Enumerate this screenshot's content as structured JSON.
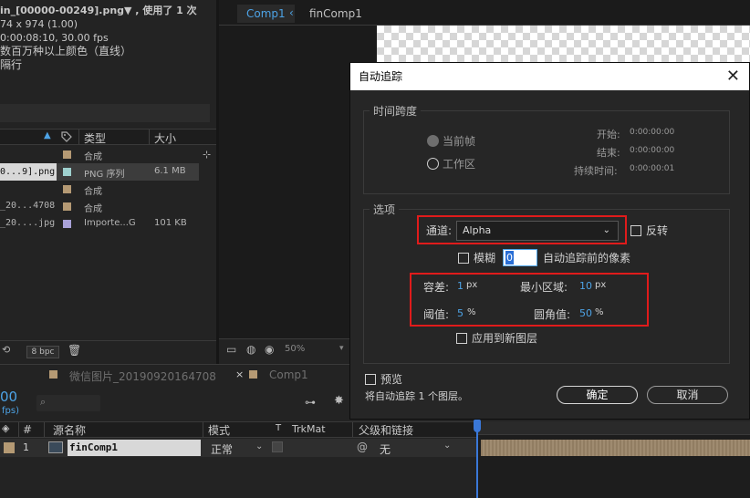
{
  "project": {
    "info_line1": "in_[00000-00249].png▼ , 使用了 1 次",
    "info_line2": "74 x 974 (1.00)",
    "info_line3": "0:00:08:10, 30.00 fps",
    "info_line4": "数百万种以上颜色（直线）",
    "info_line5": "隔行",
    "col_type": "类型",
    "col_size": "大小",
    "rows": [
      {
        "name": "",
        "type": "合成",
        "size": "",
        "color": "#b59a74"
      },
      {
        "name": "0...9].png",
        "type": "PNG 序列",
        "size": "6.1 MB",
        "color": "#9fd1cf"
      },
      {
        "name": "",
        "type": "合成",
        "size": "",
        "color": "#b59a74"
      },
      {
        "name": "_20...4708",
        "type": "合成",
        "size": "",
        "color": "#b59a74"
      },
      {
        "name": "_20....jpg",
        "type": "Importe...G",
        "size": "101 KB",
        "color": "#a9a1d8"
      }
    ],
    "bpc": "8 bpc"
  },
  "comp": {
    "tab_active": "Comp1",
    "tab_other": "finComp1",
    "zoom": "50%"
  },
  "timeline": {
    "tab1": "微信图片_20190920164708",
    "tab2": "Comp1",
    "timecode": "00",
    "fps": "fps)",
    "col_num": "#",
    "col_source": "源名称",
    "col_mode": "模式",
    "col_t": "T",
    "col_trkmat": "TrkMat",
    "col_parent": "父级和链接",
    "layer_num": "1",
    "layer_name": "finComp1",
    "layer_mode": "正常",
    "layer_parent": "无"
  },
  "dialog": {
    "title": "自动追踪",
    "time_group": "时间跨度",
    "current_frame": "当前帧",
    "work_area": "工作区",
    "start_label": "开始:",
    "start_value": "0:00:00:00",
    "end_label": "结束:",
    "end_value": "0:00:00:00",
    "duration_label": "持续时间:",
    "duration_value": "0:00:00:01",
    "options_group": "选项",
    "channel_label": "通道:",
    "channel_value": "Alpha",
    "invert_label": "反转",
    "blur_label": "模糊",
    "blur_value": "0",
    "blur_suffix": "自动追踪前的像素",
    "tolerance_label": "容差:",
    "tolerance_value": "1",
    "tolerance_unit": "px",
    "min_area_label": "最小区域:",
    "min_area_value": "10",
    "min_area_unit": "px",
    "threshold_label": "阈值:",
    "threshold_value": "5",
    "threshold_unit": "%",
    "corner_label": "圆角值:",
    "corner_value": "50",
    "corner_unit": "%",
    "apply_new_layer": "应用到新图层",
    "preview_label": "预览",
    "status": "将自动追踪 1 个图层。",
    "ok_label": "确定",
    "cancel_label": "取消"
  }
}
